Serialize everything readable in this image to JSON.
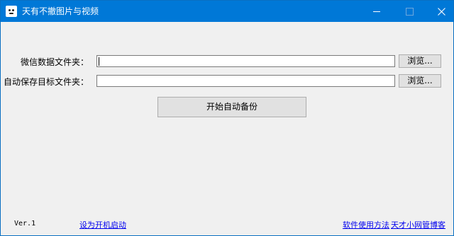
{
  "window": {
    "title": "天有不撤图片与视频"
  },
  "form": {
    "wechat_label": "微信数据文件夹：",
    "wechat_value": "",
    "target_label": "自动保存目标文件夹：",
    "target_value": "",
    "browse_label_1": "浏览...",
    "browse_label_2": "浏览..."
  },
  "actions": {
    "start_label": "开始自动备份"
  },
  "footer": {
    "version": "Ver.1",
    "autostart_link": "设为开机启动",
    "usage_link": "软件使用方法",
    "blog_link": "天才小网管博客"
  }
}
